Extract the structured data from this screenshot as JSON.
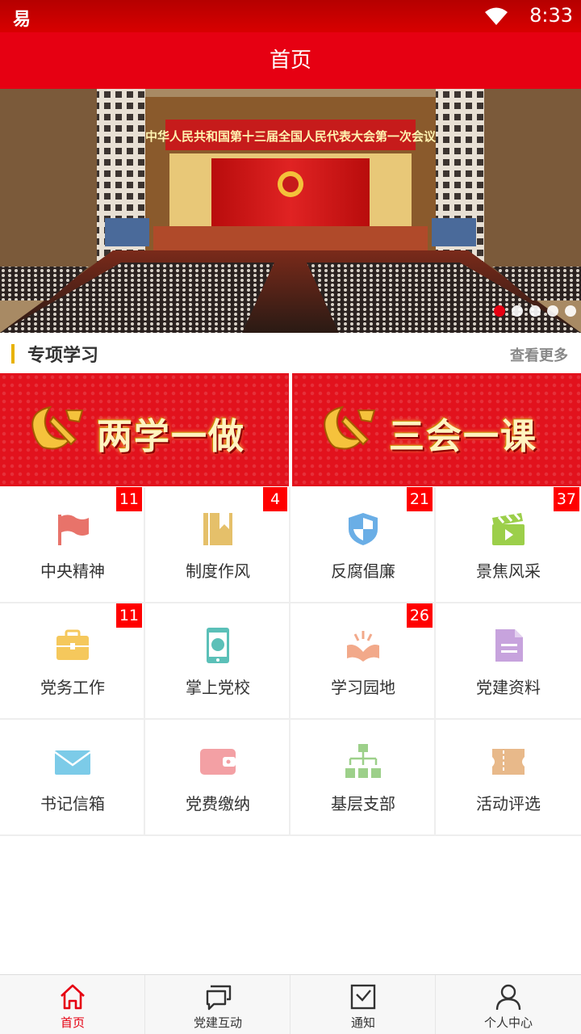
{
  "status_bar": {
    "time": "8:33",
    "app_glyph": "易"
  },
  "title_bar": {
    "title": "首页"
  },
  "banner": {
    "caption": "中华人民共和国第十三届全国人民代表大会第一次会议",
    "slide_count": 5,
    "active_slide": 1
  },
  "section": {
    "title": "专项学习",
    "more": "查看更多"
  },
  "promos": [
    {
      "label": "两学一做"
    },
    {
      "label": "三会一课"
    }
  ],
  "grid": [
    [
      {
        "label": "中央精神",
        "badge": "11",
        "icon": "flag-icon"
      },
      {
        "label": "制度作风",
        "badge": "4",
        "icon": "book-icon"
      },
      {
        "label": "反腐倡廉",
        "badge": "21",
        "icon": "shield-icon"
      },
      {
        "label": "景焦风采",
        "badge": "37",
        "icon": "clapperboard-icon"
      }
    ],
    [
      {
        "label": "党务工作",
        "badge": "11",
        "icon": "briefcase-icon"
      },
      {
        "label": "掌上党校",
        "badge": "",
        "icon": "phone-emblem-icon"
      },
      {
        "label": "学习园地",
        "badge": "26",
        "icon": "open-book-icon"
      },
      {
        "label": "党建资料",
        "badge": "",
        "icon": "document-icon"
      }
    ],
    [
      {
        "label": "书记信箱",
        "badge": "",
        "icon": "mail-icon"
      },
      {
        "label": "党费缴纳",
        "badge": "",
        "icon": "wallet-icon"
      },
      {
        "label": "基层支部",
        "badge": "",
        "icon": "org-chart-icon"
      },
      {
        "label": "活动评选",
        "badge": "",
        "icon": "ticket-icon"
      }
    ]
  ],
  "bottom_nav": [
    {
      "label": "首页",
      "icon": "home-icon",
      "active": true
    },
    {
      "label": "党建互动",
      "icon": "chat-icon",
      "active": false
    },
    {
      "label": "通知",
      "icon": "inbox-icon",
      "active": false
    },
    {
      "label": "个人中心",
      "icon": "user-icon",
      "active": false
    }
  ],
  "colors": {
    "primary": "#e60012",
    "badge": "#ff0000",
    "accent_bar": "#e8b200"
  }
}
